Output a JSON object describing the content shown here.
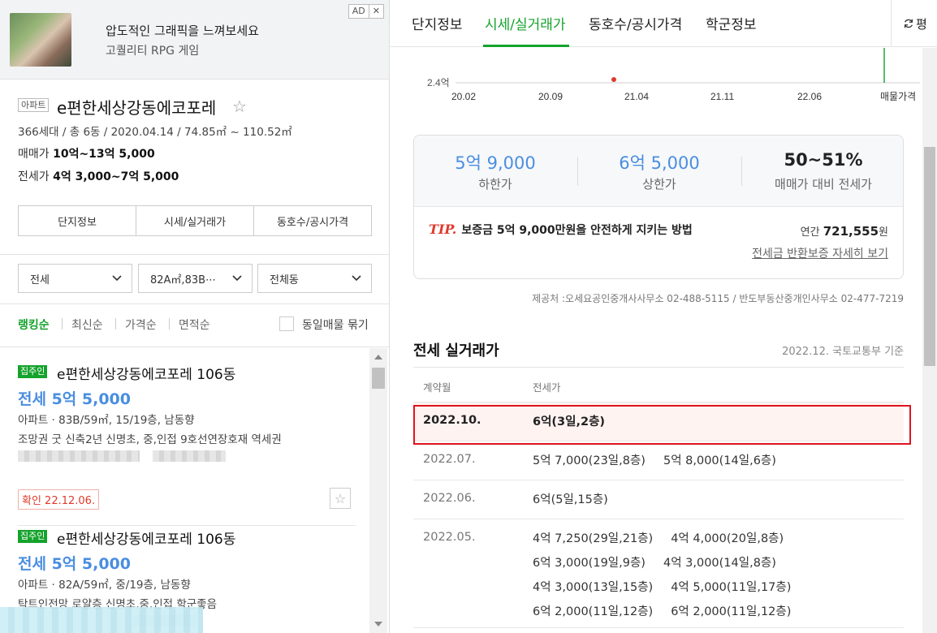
{
  "ad": {
    "title": "압도적인 그래픽을 느껴보세요",
    "subtitle": "고퀄리티 RPG 게임",
    "badge": "AD",
    "close": "✕"
  },
  "complex": {
    "type": "아파트",
    "name": "e편한세상강동에코포레",
    "meta": "366세대 / 총 6동 / 2020.04.14 / 74.85㎡ ~ 110.52㎡",
    "sale_label": "매매가",
    "sale_value": "10억~13억 5,000",
    "jeonse_label": "전세가",
    "jeonse_value": "4억 3,000~7억 5,000",
    "tabs": [
      "단지정보",
      "시세/실거래가",
      "동호수/공시가격"
    ]
  },
  "filters": {
    "trade": "전세",
    "area": "82A㎡,83B⋯",
    "dong": "전체동"
  },
  "sort": {
    "items": [
      "랭킹순",
      "최신순",
      "가격순",
      "면적순"
    ],
    "checkbox_label": "동일매물 묶기"
  },
  "listings": [
    {
      "badge": "집주인",
      "name": "e편한세상강동에코포레 106동",
      "price": "전세 5억 5,000",
      "spec": "아파트 · 83B/59㎡, 15/19층, 남동향",
      "desc": "조망권 굿 신축2년 신명초, 중,인접 9호선연장호재 역세권",
      "confirm": "확인 22.12.06."
    },
    {
      "badge": "집주인",
      "name": "e편한세상강동에코포레 106동",
      "price": "전세 5억 5,000",
      "spec": "아파트 · 82A/59㎡, 중/19층, 남동향",
      "desc": "탁트인전망 로얄층 신명초,중,인접 학군좋음"
    }
  ],
  "right_tabs": {
    "items": [
      "단지정보",
      "시세/실거래가",
      "동호수/공시가격",
      "학군정보"
    ],
    "refresh_label": "평"
  },
  "chart_data": {
    "type": "scatter",
    "x_ticks": [
      "20.02",
      "20.09",
      "21.04",
      "21.11",
      "22.06"
    ],
    "y_tick": "2.4억",
    "legend_label": "매물가격",
    "points": [
      {
        "x": "2021.01",
        "y": 2.4
      }
    ],
    "marker_color": "#e0392b",
    "current_line_color": "#14a32b"
  },
  "stats": {
    "low_value": "5억 9,000",
    "low_label": "하한가",
    "high_value": "6억 5,000",
    "high_label": "상한가",
    "ratio_value": "50~51%",
    "ratio_label": "매매가 대비 전세가",
    "tip_mark": "TIP.",
    "tip_text": "보증금 5억 9,000만원을 안전하게 지키는 방법",
    "annual_prefix": "연간",
    "annual_value": "721,555",
    "annual_unit": "원",
    "link": "전세금 반환보증 자세히 보기"
  },
  "source": "제공처 :오세요공인중개사사무소 02-488-5115 / 반도부동산중개인사무소 02-477-7219",
  "transactions": {
    "title": "전세 실거래가",
    "basis": "2022.12. 국토교통부 기준",
    "col_date": "계약월",
    "col_price": "전세가",
    "rows": [
      {
        "date": "2022.10.",
        "lines": [
          [
            "6억(3일,2층)"
          ]
        ]
      },
      {
        "date": "2022.07.",
        "lines": [
          [
            "5억 7,000(23일,8층)",
            "5억 8,000(14일,6층)"
          ]
        ]
      },
      {
        "date": "2022.06.",
        "lines": [
          [
            "6억(5일,15층)"
          ]
        ]
      },
      {
        "date": "2022.05.",
        "lines": [
          [
            "4억 7,250(29일,21층)",
            "4억 4,000(20일,8층)"
          ],
          [
            "6억 3,000(19일,9층)",
            "4억 3,000(14일,8층)"
          ],
          [
            "4억 3,000(13일,15층)",
            "4억 5,000(11일,17층)"
          ],
          [
            "6억 2,000(11일,12층)",
            "6억 2,000(11일,12층)"
          ]
        ]
      }
    ]
  },
  "colors": {
    "accent": "#14a32b",
    "price_blue": "#4a8ee0",
    "highlight_red": "#e0141e"
  }
}
